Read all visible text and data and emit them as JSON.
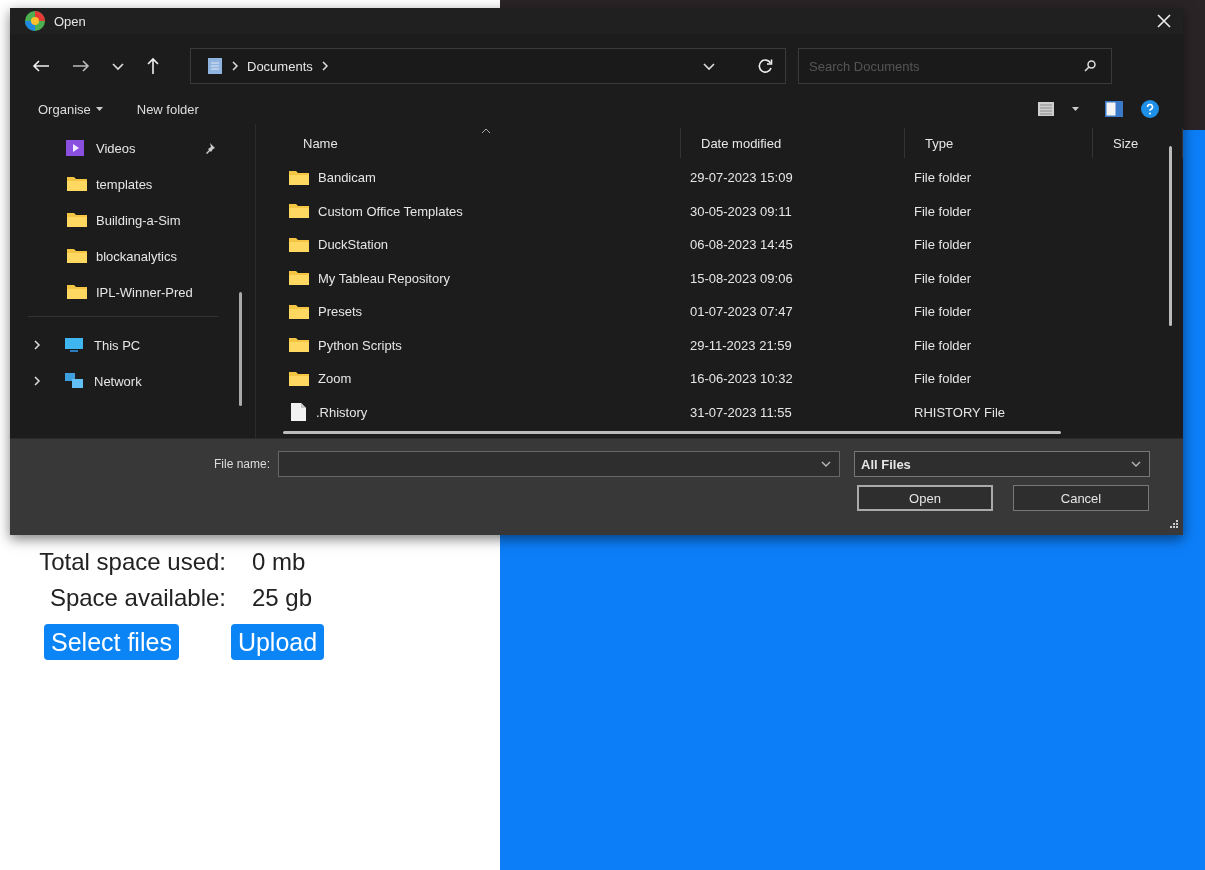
{
  "page": {
    "stats": [
      {
        "label": "Total space used:",
        "value": "0 mb"
      },
      {
        "label": "Space available:",
        "value": "25 gb"
      }
    ],
    "buttons": [
      "Select files",
      "Upload"
    ]
  },
  "dialog": {
    "title": "Open",
    "address": {
      "path": [
        "Documents"
      ]
    },
    "search": {
      "placeholder": "Search Documents"
    },
    "toolbar": [
      {
        "label": "Organise",
        "kind": "menu"
      },
      {
        "label": "New folder",
        "kind": "plain"
      }
    ],
    "sidebar": {
      "quick_access": [
        {
          "label": "Videos",
          "kind": "videos",
          "pinned": true
        },
        {
          "label": "templates",
          "kind": "folder",
          "pinned": false
        },
        {
          "label": "Building-a-Sim",
          "kind": "folder",
          "pinned": false
        },
        {
          "label": "blockanalytics",
          "kind": "folder",
          "pinned": false
        },
        {
          "label": "IPL-Winner-Pred",
          "kind": "folder",
          "pinned": false
        }
      ],
      "locations": [
        {
          "label": "This PC",
          "kind": "pc",
          "expanded": false
        },
        {
          "label": "Network",
          "kind": "network",
          "expanded": false
        }
      ]
    },
    "table": {
      "columns": [
        "Name",
        "Date modified",
        "Type",
        "Size"
      ],
      "rows": [
        {
          "kind": "folder",
          "name": "Bandicam",
          "date": "29-07-2023 15:09",
          "type": "File folder"
        },
        {
          "kind": "folder",
          "name": "Custom Office Templates",
          "date": "30-05-2023 09:11",
          "type": "File folder"
        },
        {
          "kind": "folder",
          "name": "DuckStation",
          "date": "06-08-2023 14:45",
          "type": "File folder"
        },
        {
          "kind": "folder",
          "name": "My Tableau Repository",
          "date": "15-08-2023 09:06",
          "type": "File folder"
        },
        {
          "kind": "folder",
          "name": "Presets",
          "date": "01-07-2023 07:47",
          "type": "File folder"
        },
        {
          "kind": "folder",
          "name": "Python Scripts",
          "date": "29-11-2023 21:59",
          "type": "File folder"
        },
        {
          "kind": "folder",
          "name": "Zoom",
          "date": "16-06-2023 10:32",
          "type": "File folder"
        },
        {
          "kind": "file",
          "name": ".Rhistory",
          "date": "31-07-2023 11:55",
          "type": "RHISTORY File"
        }
      ]
    },
    "footer": {
      "file_name_label": "File name:",
      "filter": "All Files",
      "buttons": [
        {
          "label": "Open",
          "default": true
        },
        {
          "label": "Cancel",
          "default": false
        }
      ]
    }
  }
}
